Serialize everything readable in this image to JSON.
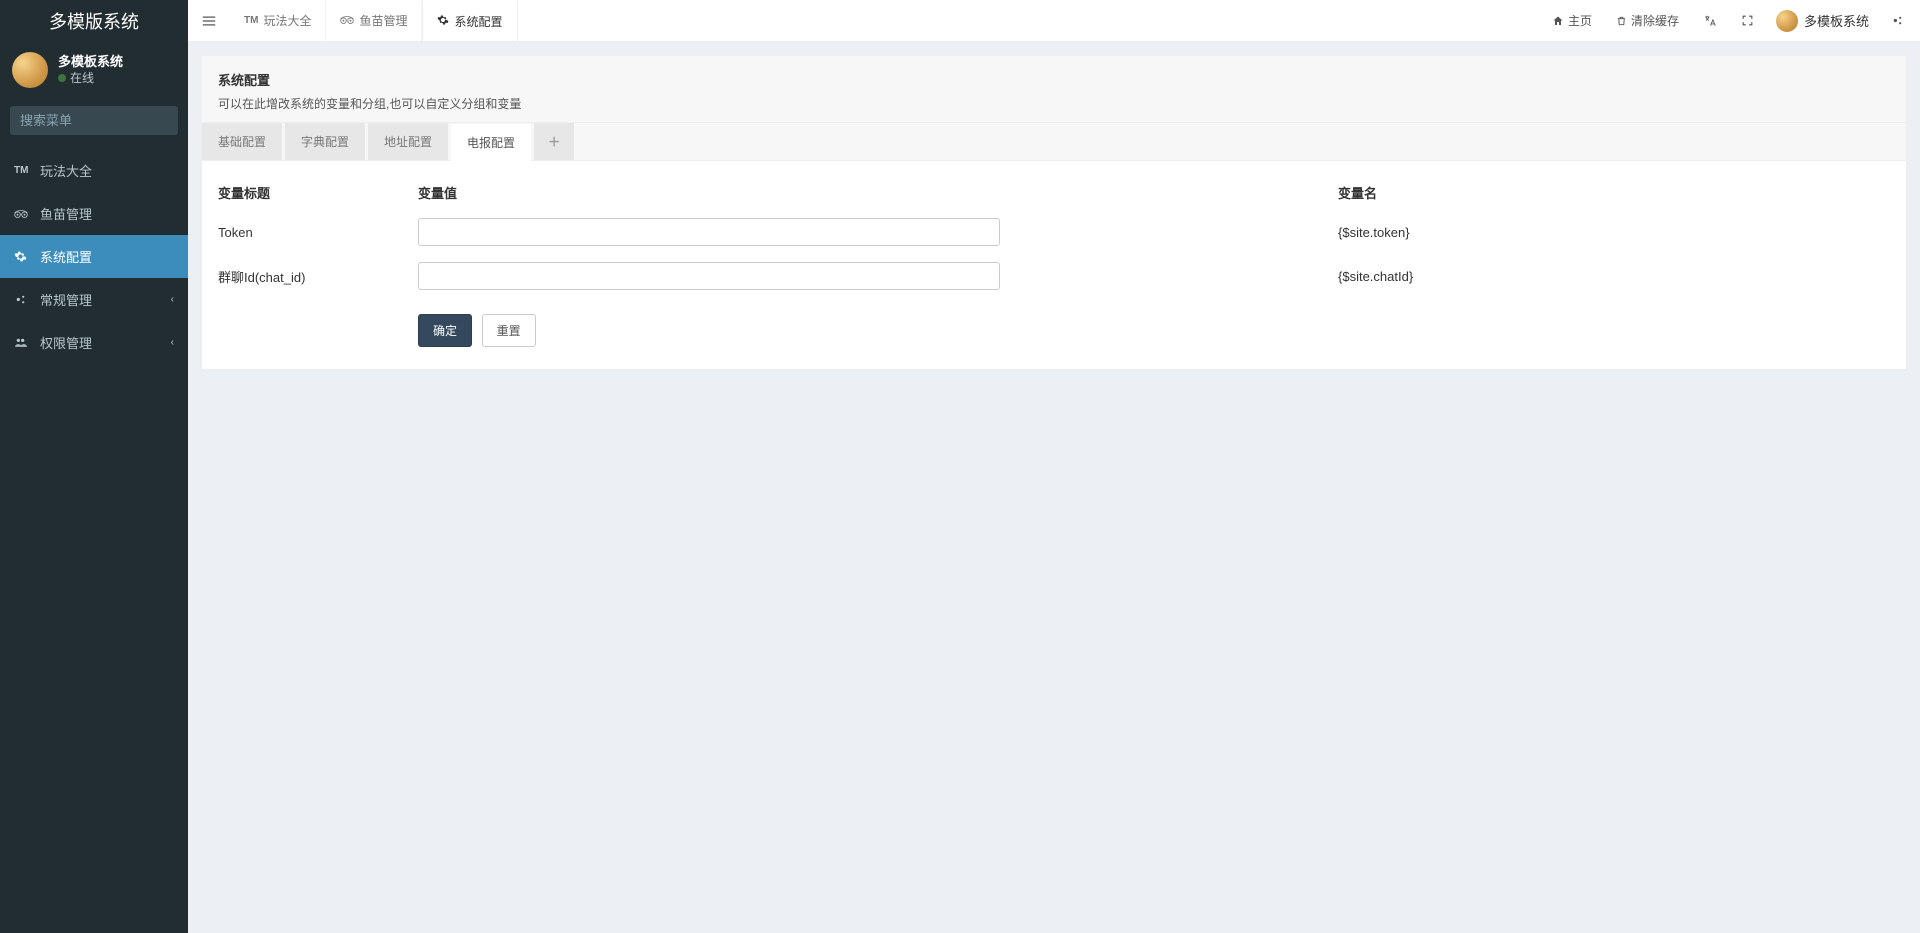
{
  "brand": "多模版系统",
  "user": {
    "name": "多模板系统",
    "status": "在线"
  },
  "search": {
    "placeholder": "搜索菜单"
  },
  "sidebar": {
    "items": [
      {
        "icon": "TM",
        "label": "玩法大全",
        "expandable": false
      },
      {
        "icon": "trip",
        "label": "鱼苗管理",
        "expandable": false
      },
      {
        "icon": "gear",
        "label": "系统配置",
        "expandable": false,
        "active": true
      },
      {
        "icon": "cogs",
        "label": "常规管理",
        "expandable": true
      },
      {
        "icon": "group",
        "label": "权限管理",
        "expandable": true
      }
    ]
  },
  "topTabs": [
    {
      "icon": "TM",
      "label": "玩法大全"
    },
    {
      "icon": "trip",
      "label": "鱼苗管理"
    },
    {
      "icon": "gear",
      "label": "系统配置",
      "active": true
    }
  ],
  "topActions": {
    "home": "主页",
    "clearCache": "清除缓存",
    "userLabel": "多模板系统"
  },
  "panel": {
    "title": "系统配置",
    "desc": "可以在此增改系统的变量和分组,也可以自定义分组和变量"
  },
  "cfgTabs": [
    {
      "label": "基础配置"
    },
    {
      "label": "字典配置"
    },
    {
      "label": "地址配置"
    },
    {
      "label": "电报配置",
      "active": true
    }
  ],
  "columns": {
    "title": "变量标题",
    "value": "变量值",
    "name": "变量名"
  },
  "rows": [
    {
      "title": "Token",
      "value": "",
      "name": "{$site.token}"
    },
    {
      "title": "群聊Id(chat_id)",
      "value": "",
      "name": "{$site.chatId}"
    }
  ],
  "buttons": {
    "submit": "确定",
    "reset": "重置"
  }
}
